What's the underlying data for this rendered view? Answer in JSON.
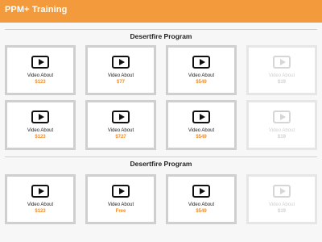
{
  "app": {
    "title": "PPM+ Training"
  },
  "sections": [
    {
      "title": "Desertfire Program"
    },
    {
      "title": "Desertfire  Program"
    }
  ],
  "grids": [
    {
      "cards": [
        {
          "label": "Video About",
          "price": "$123",
          "disabled": false
        },
        {
          "label": "Video About",
          "price": "$77",
          "disabled": false
        },
        {
          "label": "Video About",
          "price": "$549",
          "disabled": false
        },
        {
          "label": "Video About",
          "price": "$19",
          "disabled": true
        }
      ]
    },
    {
      "cards": [
        {
          "label": "Video About",
          "price": "$123",
          "disabled": false
        },
        {
          "label": "Video About",
          "price": "$727",
          "disabled": false
        },
        {
          "label": "Video About",
          "price": "$549",
          "disabled": false
        },
        {
          "label": "Video About",
          "price": "$19",
          "disabled": true
        }
      ]
    },
    {
      "cards": [
        {
          "label": "Video About",
          "price": "$123",
          "disabled": false
        },
        {
          "label": "Video About",
          "price": "Free",
          "disabled": false
        },
        {
          "label": "Video About",
          "price": "$549",
          "disabled": false
        },
        {
          "label": "Video About",
          "price": "$19",
          "disabled": true
        }
      ]
    }
  ],
  "icons": {
    "card_icon": "play-icon"
  },
  "colors": {
    "accent": "#f39b3c",
    "price": "#f28c28",
    "disabled": "#d0d0d0"
  }
}
